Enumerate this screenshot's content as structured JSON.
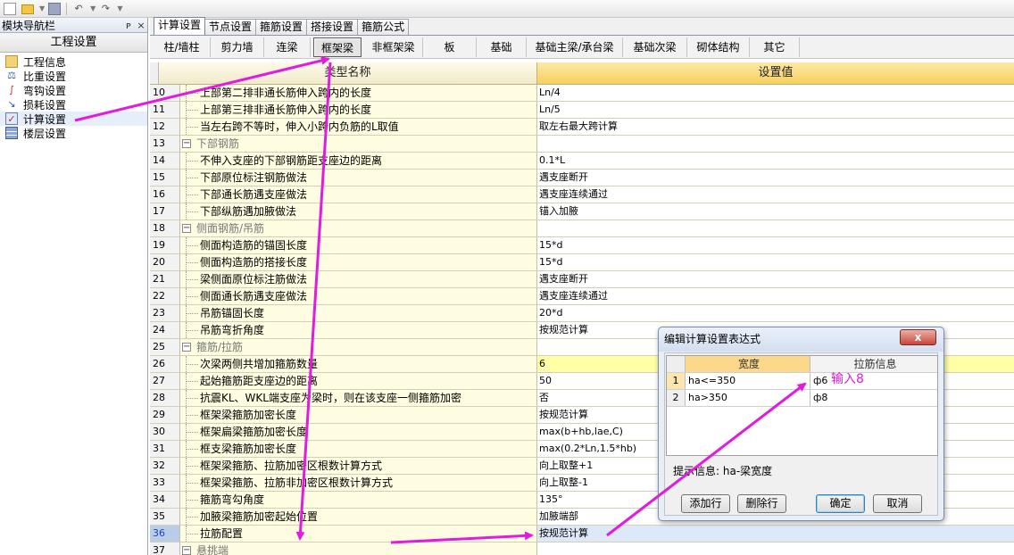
{
  "toolbar": {
    "icons": [
      "new-file-icon",
      "open-folder-icon",
      "save-icon",
      "undo-icon",
      "redo-icon"
    ]
  },
  "nav": {
    "title": "模块导航栏",
    "pin": "ᴘ",
    "close": "×",
    "section": "工程设置",
    "items": [
      {
        "label": "工程信息",
        "icon": "project-info-icon"
      },
      {
        "label": "比重设置",
        "icon": "weight-icon"
      },
      {
        "label": "弯钩设置",
        "icon": "hook-icon"
      },
      {
        "label": "损耗设置",
        "icon": "loss-icon"
      },
      {
        "label": "计算设置",
        "icon": "calc-settings-icon"
      },
      {
        "label": "楼层设置",
        "icon": "floor-icon"
      }
    ]
  },
  "tabs": [
    "计算设置",
    "节点设置",
    "箍筋设置",
    "搭接设置",
    "箍筋公式"
  ],
  "subtabs": [
    "柱/墙柱",
    "剪力墙",
    "连梁",
    "框架梁",
    "非框架梁",
    "板",
    "基础",
    "基础主梁/承台梁",
    "基础次梁",
    "砌体结构",
    "其它"
  ],
  "grid": {
    "col_name": "类型名称",
    "col_value": "设置值",
    "rows": [
      {
        "n": "10",
        "name": "上部第二排非通长筋伸入跨内的长度",
        "value": "Ln/4"
      },
      {
        "n": "11",
        "name": "上部第三排非通长筋伸入跨内的长度",
        "value": "Ln/5"
      },
      {
        "n": "12",
        "name": "当左右跨不等时，伸入小跨内负筋的L取值",
        "value": "取左右最大跨计算"
      },
      {
        "n": "13",
        "name": "下部钢筋",
        "value": "",
        "section": true
      },
      {
        "n": "14",
        "name": "不伸入支座的下部钢筋距支座边的距离",
        "value": "0.1*L"
      },
      {
        "n": "15",
        "name": "下部原位标注钢筋做法",
        "value": "遇支座断开"
      },
      {
        "n": "16",
        "name": "下部通长筋遇支座做法",
        "value": "遇支座连续通过"
      },
      {
        "n": "17",
        "name": "下部纵筋遇加腋做法",
        "value": "锚入加腋"
      },
      {
        "n": "18",
        "name": "侧面钢筋/吊筋",
        "value": "",
        "section": true
      },
      {
        "n": "19",
        "name": "侧面构造筋的锚固长度",
        "value": "15*d"
      },
      {
        "n": "20",
        "name": "侧面构造筋的搭接长度",
        "value": "15*d"
      },
      {
        "n": "21",
        "name": "梁侧面原位标注筋做法",
        "value": "遇支座断开"
      },
      {
        "n": "22",
        "name": "侧面通长筋遇支座做法",
        "value": "遇支座连续通过"
      },
      {
        "n": "23",
        "name": "吊筋锚固长度",
        "value": "20*d"
      },
      {
        "n": "24",
        "name": "吊筋弯折角度",
        "value": "按规范计算"
      },
      {
        "n": "25",
        "name": "箍筋/拉筋",
        "value": "",
        "section": true
      },
      {
        "n": "26",
        "name": "次梁两侧共增加箍筋数量",
        "value": "6"
      },
      {
        "n": "27",
        "name": "起始箍筋距支座边的距离",
        "value": "50"
      },
      {
        "n": "28",
        "name": "抗震KL、WKL端支座为梁时，则在该支座一侧箍筋加密",
        "value": "否"
      },
      {
        "n": "29",
        "name": "框架梁箍筋加密长度",
        "value": "按规范计算"
      },
      {
        "n": "30",
        "name": "框架扁梁箍筋加密长度",
        "value": "max(b+hb,lae,C)"
      },
      {
        "n": "31",
        "name": "框支梁箍筋加密长度",
        "value": "max(0.2*Ln,1.5*hb)"
      },
      {
        "n": "32",
        "name": "框架梁箍筋、拉筋加密区根数计算方式",
        "value": "向上取整+1"
      },
      {
        "n": "33",
        "name": "框架梁箍筋、拉筋非加密区根数计算方式",
        "value": "向上取整-1"
      },
      {
        "n": "34",
        "name": "箍筋弯勾角度",
        "value": "135°"
      },
      {
        "n": "35",
        "name": "加腋梁箍筋加密起始位置",
        "value": "加腋端部"
      },
      {
        "n": "36",
        "name": "拉筋配置",
        "value": "按规范计算"
      },
      {
        "n": "37",
        "name": "悬挑端",
        "value": "",
        "section": true
      }
    ]
  },
  "dialog": {
    "title": "编辑计算设置表达式",
    "close": "x",
    "col_width": "宽度",
    "col_tie": "拉筋信息",
    "rows": [
      {
        "n": "1",
        "width": "ha<=350",
        "tie": "ф6"
      },
      {
        "n": "2",
        "width": "ha>350",
        "tie": "ф8"
      }
    ],
    "hint": "提示信息: ha-梁宽度",
    "add_row": "添加行",
    "delete_row": "删除行",
    "ok": "确定",
    "cancel": "取消"
  },
  "annotation": {
    "text": "输入8",
    "color": "#e21cde"
  }
}
